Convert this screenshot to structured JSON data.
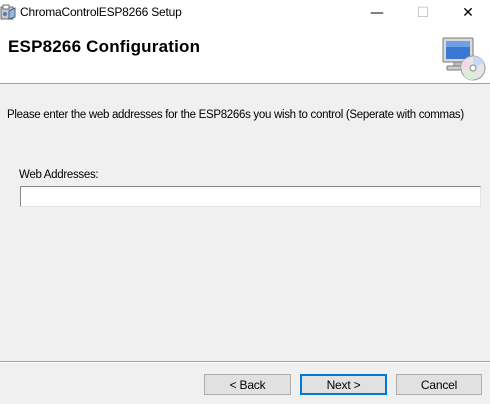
{
  "window": {
    "title": "ChromaControlESP8266 Setup",
    "controls": {
      "minimize_glyph": "—",
      "maximize_glyph": "☐",
      "close_glyph": "✕"
    },
    "app_icon": "installer-icon"
  },
  "banner": {
    "title": "ESP8266 Configuration",
    "icon": "computer-cd-icon"
  },
  "content": {
    "instruction": "Please enter the web addresses for the ESP8266s you wish to control (Seperate with commas)",
    "field_label": "Web Addresses:",
    "field_value": "",
    "field_placeholder": ""
  },
  "footer": {
    "back_label": "< Back",
    "next_label": "Next >",
    "cancel_label": "Cancel"
  },
  "colors": {
    "background": "#f0f0f0",
    "banner_background": "#ffffff",
    "default_button_border": "#0078d7",
    "button_face": "#e1e1e1"
  }
}
